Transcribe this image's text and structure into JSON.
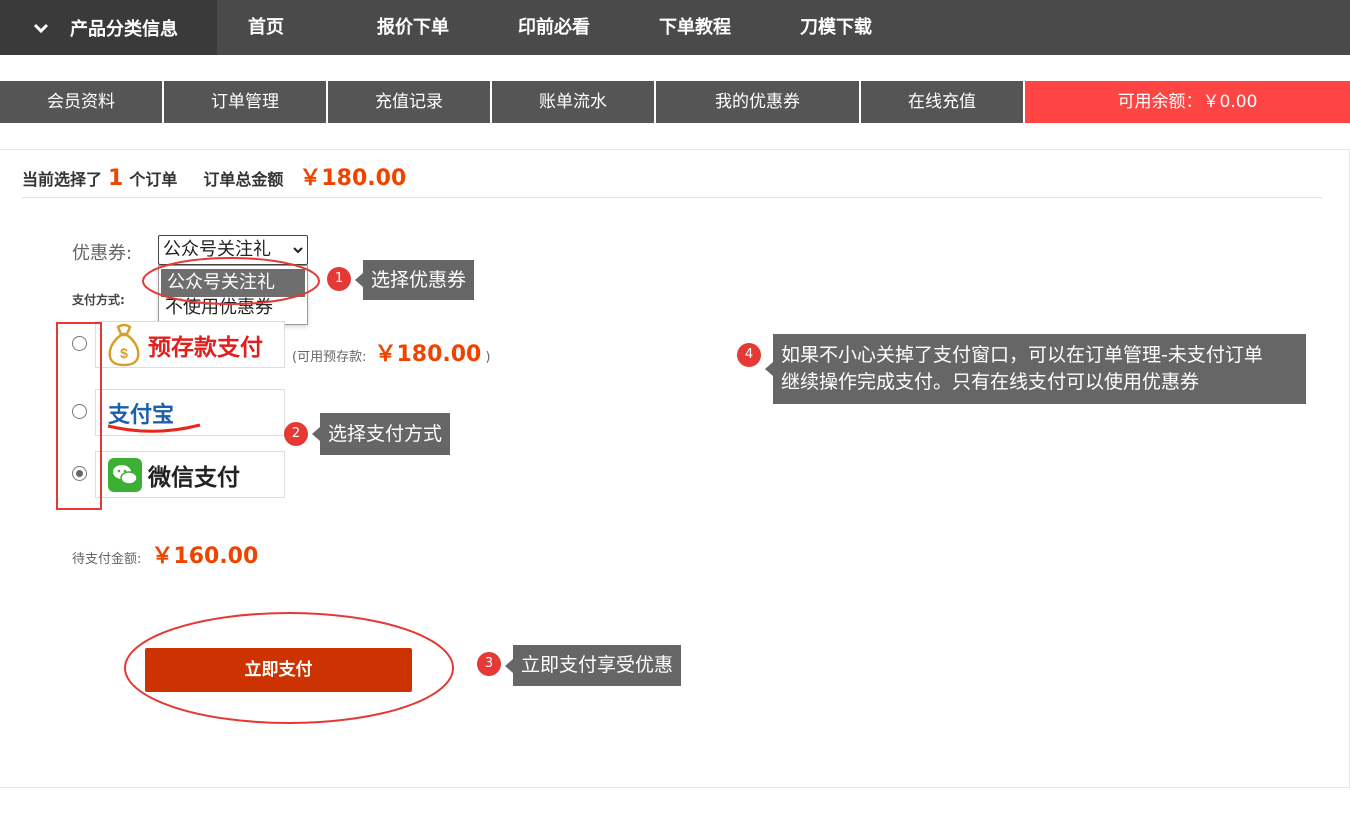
{
  "topnav": {
    "category_label": "产品分类信息",
    "items": [
      "首页",
      "报价下单",
      "印前必看",
      "下单教程",
      "刀模下载"
    ]
  },
  "member_tabs": [
    "会员资料",
    "订单管理",
    "充值记录",
    "账单流水",
    "我的优惠券",
    "在线充值"
  ],
  "balance": "可用余额：￥0.00",
  "summary": {
    "prefix": "当前选择了",
    "count": "1",
    "suffix": "个订单",
    "total_label": "订单总金额",
    "total": "￥180.00"
  },
  "coupon": {
    "label": "优惠券:",
    "selected": "公众号关注礼",
    "options": [
      "公众号关注礼",
      "不使用优惠券"
    ]
  },
  "payment": {
    "label": "支付方式:",
    "methods": [
      {
        "name": "预存款支付",
        "icon": "money-bag-icon",
        "checked": false
      },
      {
        "name": "支付宝",
        "icon": "alipay-logo",
        "checked": false
      },
      {
        "name": "微信支付",
        "icon": "wechat-icon",
        "checked": true
      }
    ],
    "avail_open": "(可用预存款:",
    "avail_amount": "￥180.00",
    "avail_close": ")"
  },
  "due": {
    "label": "待支付金额:",
    "amount": "￥160.00"
  },
  "pay_button": "立即支付",
  "annotations": [
    {
      "num": "1",
      "text": "选择优惠券"
    },
    {
      "num": "2",
      "text": "选择支付方式"
    },
    {
      "num": "3",
      "text": "立即支付享受优惠"
    },
    {
      "num": "4",
      "line1": "如果不小心关掉了支付窗口，可以在订单管理-未支付订单",
      "line2": "继续操作完成支付。只有在线支付可以使用优惠券"
    }
  ],
  "colors": {
    "accent_red": "#ee4400",
    "pay_button": "#cc3300",
    "balance_bg": "#ff4444",
    "nav_bg": "#4a4a4a",
    "annotation_red": "#e53935"
  }
}
